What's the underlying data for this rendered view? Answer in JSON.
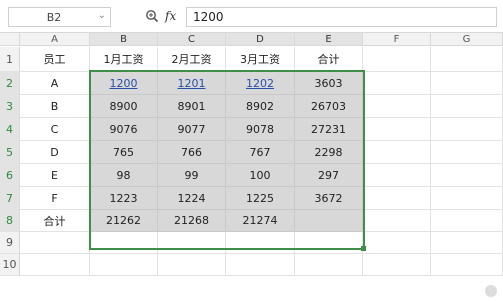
{
  "toolbar": {
    "name_box": "B2",
    "zoom_icon": "zoom-icon",
    "fx_label": "fx",
    "formula_value": "1200"
  },
  "columns": [
    "A",
    "B",
    "C",
    "D",
    "E",
    "F",
    "G"
  ],
  "rows": [
    "1",
    "2",
    "3",
    "4",
    "5",
    "6",
    "7",
    "8",
    "9",
    "10"
  ],
  "table": {
    "headers": [
      "员工",
      "1月工资",
      "2月工资",
      "3月工资",
      "合计"
    ],
    "rows": [
      [
        "A",
        "1200",
        "1201",
        "1202",
        "3603"
      ],
      [
        "B",
        "8900",
        "8901",
        "8902",
        "26703"
      ],
      [
        "C",
        "9076",
        "9077",
        "9078",
        "27231"
      ],
      [
        "D",
        "765",
        "766",
        "767",
        "2298"
      ],
      [
        "E",
        "98",
        "99",
        "100",
        "297"
      ],
      [
        "F",
        "1223",
        "1224",
        "1225",
        "3672"
      ],
      [
        "合计",
        "21262",
        "21268",
        "21274",
        ""
      ]
    ]
  },
  "selection": "B2:E8",
  "colors": {
    "selection_border": "#3f8f4b",
    "shaded_cell": "#d8d8d8",
    "link_text": "#2a4fa8"
  }
}
